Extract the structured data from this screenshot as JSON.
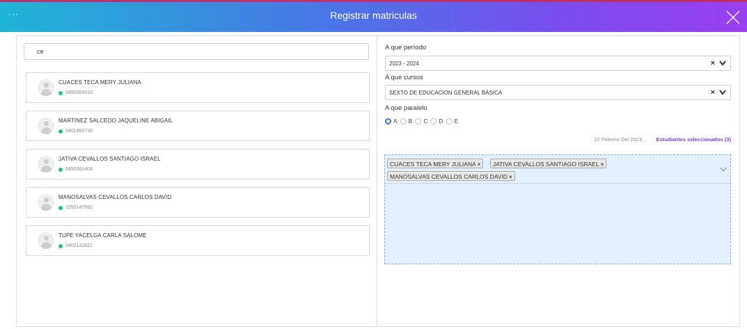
{
  "header": {
    "menu_label": "···",
    "title": "Registrar matriculas",
    "close_icon": "close-icon"
  },
  "search": {
    "value": "ce"
  },
  "students": [
    {
      "name": "CUACES TECA MERY JULIANA",
      "id": "0450369533"
    },
    {
      "name": "MARTINEZ SALCEDO JAQUELINE ABIGAIL",
      "id": "0401983739"
    },
    {
      "name": "JATIVA CEVALLOS SANTIAGO ISRAEL",
      "id": "0450061403"
    },
    {
      "name": "MANOSALVAS CEVALLOS CARLOS DAVID",
      "id": "1050147592"
    },
    {
      "name": "TUPE YACELGA CARLA SALOME",
      "id": "0402142822"
    }
  ],
  "form": {
    "period_label": "A que período",
    "period_value": "2023 - 2024",
    "course_label": "A que cursos",
    "course_value": "SEXTO DE EDUCACION GENERAL BÁSICA",
    "parallel_label": "A que paralelo",
    "parallels": [
      "A",
      "B",
      "C",
      "D",
      "E"
    ],
    "selected_parallel": "A",
    "clear_symbol": "×"
  },
  "summary": {
    "date": "22 Febrero Del 2023",
    "selected": "Estudiantes seleccionados (3)"
  },
  "selected_tags": [
    "CUACES TECA MERY JULIANA",
    "JATIVA CEVALLOS SANTIAGO ISRAEL",
    "MANOSALVAS CEVALLOS CARLOS DAVID"
  ],
  "colors": {
    "accent": "#3c6fe0",
    "status": "#1fbf8f",
    "link": "#7a3ff0"
  }
}
